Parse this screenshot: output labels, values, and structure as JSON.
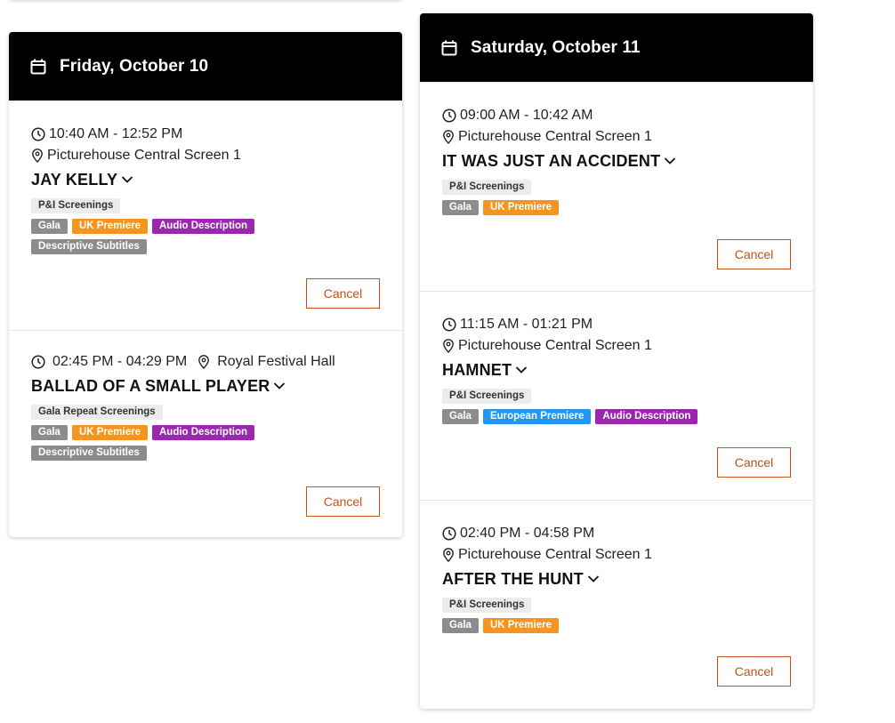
{
  "colors": {
    "header_bg": "#000000",
    "cancel": "#c0521a",
    "tag_gray": "#8c8c8c",
    "tag_orange": "#f7941d",
    "tag_purple": "#9b27af",
    "tag_blue": "#2196f3",
    "tag_light": "#ececec"
  },
  "days": [
    {
      "title": "Friday, October 10",
      "icon": "calendar-icon",
      "events": [
        {
          "time": "10:40 AM - 12:52 PM",
          "venue": "Picturehouse Central Screen 1",
          "title": "JAY KELLY",
          "category": "P&I Screenings",
          "tags_row1": [
            "Gala",
            "UK Premiere",
            "Audio Description"
          ],
          "tags_row2": [
            "Descriptive Subtitles"
          ],
          "cancel": "Cancel"
        },
        {
          "time": "02:45 PM - 04:29 PM",
          "venue": "Royal Festival Hall",
          "title": "BALLAD OF A SMALL PLAYER",
          "category": "Gala Repeat Screenings",
          "tags_row1": [
            "Gala",
            "UK Premiere",
            "Audio Description"
          ],
          "tags_row2": [
            "Descriptive Subtitles"
          ],
          "cancel": "Cancel"
        }
      ]
    },
    {
      "title": "Saturday, October 11",
      "icon": "calendar-icon",
      "events": [
        {
          "time": "09:00 AM - 10:42 AM",
          "venue": "Picturehouse Central Screen 1",
          "title": "IT WAS JUST AN ACCIDENT",
          "category": "P&I Screenings",
          "tags_row1": [
            "Gala",
            "UK Premiere"
          ],
          "cancel": "Cancel"
        },
        {
          "time": "11:15 AM - 01:21 PM",
          "venue": "Picturehouse Central Screen 1",
          "title": "HAMNET",
          "category": "P&I Screenings",
          "tags_row1": [
            "Gala",
            "European Premiere",
            "Audio Description"
          ],
          "cancel": "Cancel"
        },
        {
          "time": "02:40 PM - 04:58 PM",
          "venue": "Picturehouse Central Screen 1",
          "title": "AFTER THE HUNT",
          "category": "P&I Screenings",
          "tags_row1": [
            "Gala",
            "UK Premiere"
          ],
          "cancel": "Cancel"
        }
      ]
    }
  ]
}
